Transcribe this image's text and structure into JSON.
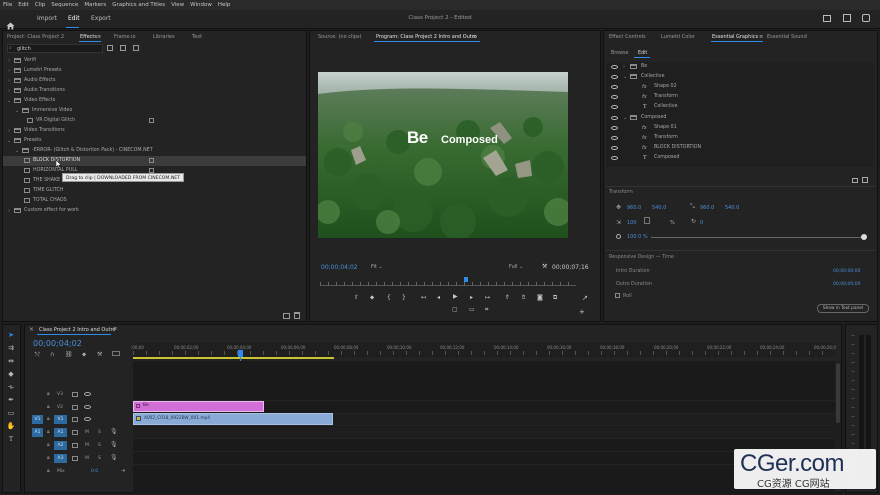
{
  "menubar": {
    "items": [
      "File",
      "Edit",
      "Clip",
      "Sequence",
      "Markers",
      "Graphics and Titles",
      "View",
      "Window",
      "Help"
    ]
  },
  "header": {
    "tabs": [
      "Import",
      "Edit",
      "Export"
    ],
    "active_tab": "Edit",
    "project_title": "Class Project 2",
    "edited_status": "- Edited"
  },
  "project_panel": {
    "tabs": [
      "Project: Class Project 2",
      "Effects",
      "Frame.io",
      "Libraries",
      "Text"
    ],
    "active_tab": "Effects",
    "search_value": "glitch",
    "tree": [
      {
        "label": "Verifi",
        "level": 0,
        "expanded": false
      },
      {
        "label": "Lumetri Presets",
        "level": 0,
        "expanded": false
      },
      {
        "label": "Audio Effects",
        "level": 0,
        "expanded": false
      },
      {
        "label": "Audio Transitions",
        "level": 0,
        "expanded": false
      },
      {
        "label": "Video Effects",
        "level": 0,
        "expanded": true
      },
      {
        "label": "Immersive Video",
        "level": 1,
        "expanded": true
      },
      {
        "label": "VR Digital Glitch",
        "level": 2,
        "expanded": false
      },
      {
        "label": "Video Transitions",
        "level": 0,
        "expanded": false
      },
      {
        "label": "Presets",
        "level": 0,
        "expanded": true
      },
      {
        "label": "-ERROR- (Glitch & Distortion Pack) - CINECOM.NET",
        "level": 1,
        "expanded": true
      },
      {
        "label": "BLOCK DISTORTION",
        "level": 2,
        "expanded": false
      },
      {
        "label": "HORIZONTAL PULL",
        "level": 2,
        "expanded": false
      },
      {
        "label": "THE SHAKE",
        "level": 2,
        "expanded": false
      },
      {
        "label": "TIME GLITCH",
        "level": 2,
        "expanded": false
      },
      {
        "label": "TOTAL CHAOS",
        "level": 2,
        "expanded": false
      },
      {
        "label": "Custom effect for work",
        "level": 0,
        "expanded": false
      }
    ],
    "tooltip": "Drag to clip | DOWNLOADED FROM CINECOM.NET"
  },
  "source_tab": "Source: (no clips)",
  "program": {
    "tab": "Program: Class Project 2 Intro and Outro",
    "overlay_text_1": "Be",
    "overlay_text_2": "Composed",
    "timecode_current": "00;00;04;02",
    "timecode_duration": "00;00;07;16",
    "fit": "Fit",
    "quality": "Full"
  },
  "eg_panel": {
    "tabs": [
      "Effect Controls",
      "Lumetri Color",
      "Essential Graphics",
      "Essential Sound"
    ],
    "active_tab": "Essential Graphics",
    "subtabs": [
      "Browse",
      "Edit"
    ],
    "active_subtab": "Edit",
    "layers": [
      {
        "label": "Be",
        "type": "group",
        "level": 0
      },
      {
        "label": "Collective",
        "type": "group",
        "level": 0
      },
      {
        "label": "Shape 02",
        "type": "fx",
        "level": 1
      },
      {
        "label": "Transform",
        "type": "fx",
        "level": 1
      },
      {
        "label": "Collective",
        "type": "text",
        "level": 1
      },
      {
        "label": "Composed",
        "type": "group",
        "level": 0
      },
      {
        "label": "Shape 01",
        "type": "fx",
        "level": 1
      },
      {
        "label": "Transform",
        "type": "fx",
        "level": 1
      },
      {
        "label": "BLOCK DISTORTION",
        "type": "fx",
        "level": 1
      },
      {
        "label": "Composed",
        "type": "text",
        "level": 1
      }
    ],
    "transform_label": "Transform",
    "pos_x": "960.0",
    "pos_y": "540.0",
    "anchor_x": "960.0",
    "anchor_y": "540.0",
    "scale": "100",
    "scale_unit": "%",
    "rotation": "0",
    "opacity": "100.0 %",
    "opacity_fraction": 1.0,
    "responsive_label": "Responsive Design — Time",
    "intro_label": "Intro Duration",
    "outro_label": "Outro Duration",
    "intro_value": "00;00;00;00",
    "outro_value": "00;00;00;00",
    "roll_label": "Roll",
    "show_text_panel": "Show in Text panel"
  },
  "timeline": {
    "tab": "Class Project 2 Intro and Outro",
    "timecode": "00;00;04;02",
    "ruler": [
      ":00;00",
      "00;00;02;00",
      "00;00;04;00",
      "00;00;06;00",
      "00;00;08;00",
      "00;00;10;00",
      "00;00;12;00",
      "00;00;14;00",
      "00;00;16;00",
      "00;00;18;00",
      "00;00;20;00",
      "00;00;22;00",
      "00;00;24;00",
      "00;00;26;0"
    ],
    "video_tracks": [
      "V3",
      "V2",
      "V1"
    ],
    "audio_tracks": [
      "A1",
      "A2",
      "A3"
    ],
    "source_patch_v": "V1",
    "source_patch_a": "A1",
    "mix_label": "Mix",
    "mix_value": "0.0",
    "clip_graphic": "Be",
    "clip_video": "A002_C018_0922BW_001.mp4",
    "m_label": "M",
    "s_label": "S"
  },
  "watermark": {
    "main": "CGer.com",
    "sub": "CG资源 CG网站"
  },
  "colors": {
    "accent_blue": "#2d8ceb",
    "clip_pink": "#d26fd6",
    "clip_blue": "#8aaad6",
    "work_area": "#c9c532"
  }
}
